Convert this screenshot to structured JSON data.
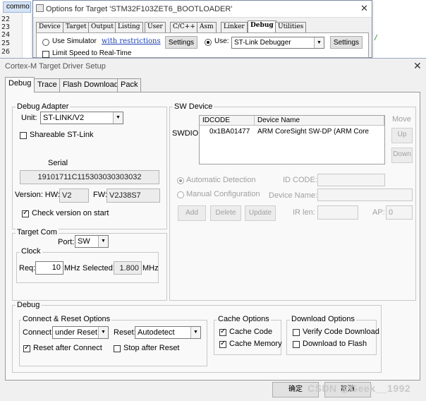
{
  "editor": {
    "tab_label": "commo",
    "line_numbers": [
      "22",
      "23",
      "24",
      "25",
      "26"
    ],
    "code_fragment": "/"
  },
  "options_dialog": {
    "title": "Options for Target 'STM32F103ZET6_BOOTLOADER'",
    "tabs": [
      "Device",
      "Target",
      "Output",
      "Listing",
      "User",
      "C/C++",
      "Asm",
      "Linker",
      "Debug",
      "Utilities"
    ],
    "use_simulator_label": "Use Simulator",
    "restrictions_link": "with restrictions",
    "settings_left": "Settings",
    "use_label": "Use:",
    "debugger_selected": "ST-Link Debugger",
    "settings_right": "Settings",
    "limit_speed_label": "Limit Speed to Real-Time"
  },
  "dialog": {
    "title": "Cortex-M Target Driver Setup",
    "tabs": [
      "Debug",
      "Trace",
      "Flash Download",
      "Pack"
    ],
    "debug_adapter": {
      "group_label": "Debug Adapter",
      "unit_label": "Unit:",
      "unit_value": "ST-LINK/V2",
      "shareable_label": "Shareable ST-Link",
      "serial_label": "Serial",
      "serial_value": "19101711C115303030303032",
      "version_label": "Version: HW:",
      "hw_value": "V2",
      "fw_label": "FW:",
      "fw_value": "V2J38S7",
      "check_version_label": "Check version on start"
    },
    "target_com": {
      "group_label": "Target Com",
      "port_label": "Port:",
      "port_value": "SW",
      "clock_label": "Clock",
      "req_label": "Req:",
      "req_value": "10",
      "req_unit": "MHz",
      "selected_label": "Selected:",
      "selected_value": "1.800",
      "selected_unit": "MHz"
    },
    "sw_device": {
      "group_label": "SW Device",
      "swdio_label": "SWDIO",
      "col_idcode": "IDCODE",
      "col_device": "Device Name",
      "row_idcode": "0x1BA01477",
      "row_device": "ARM CoreSight SW-DP (ARM Core",
      "move_label": "Move",
      "up_label": "Up",
      "down_label": "Down",
      "auto_detect_label": "Automatic Detection",
      "manual_config_label": "Manual Configuration",
      "id_code_label": "ID CODE:",
      "device_name_label": "Device Name:",
      "ir_len_label": "IR len:",
      "ap_label": "AP:",
      "ap_value": "0",
      "add_label": "Add",
      "delete_label": "Delete",
      "update_label": "Update"
    },
    "debug_group": {
      "group_label": "Debug",
      "connect_reset": {
        "group_label": "Connect & Reset Options",
        "connect_label": "Connect:",
        "connect_value": "under Reset",
        "reset_label": "Reset:",
        "reset_value": "Autodetect",
        "reset_after_connect_label": "Reset after Connect",
        "stop_after_reset_label": "Stop after Reset"
      },
      "cache": {
        "group_label": "Cache Options",
        "cache_code_label": "Cache Code",
        "cache_memory_label": "Cache Memory"
      },
      "download": {
        "group_label": "Download Options",
        "verify_label": "Verify Code Download",
        "download_flash_label": "Download to Flash"
      }
    },
    "ok_label": "确定",
    "cancel_label": "取消",
    "watermark": "CSDN @Geek__1992"
  }
}
